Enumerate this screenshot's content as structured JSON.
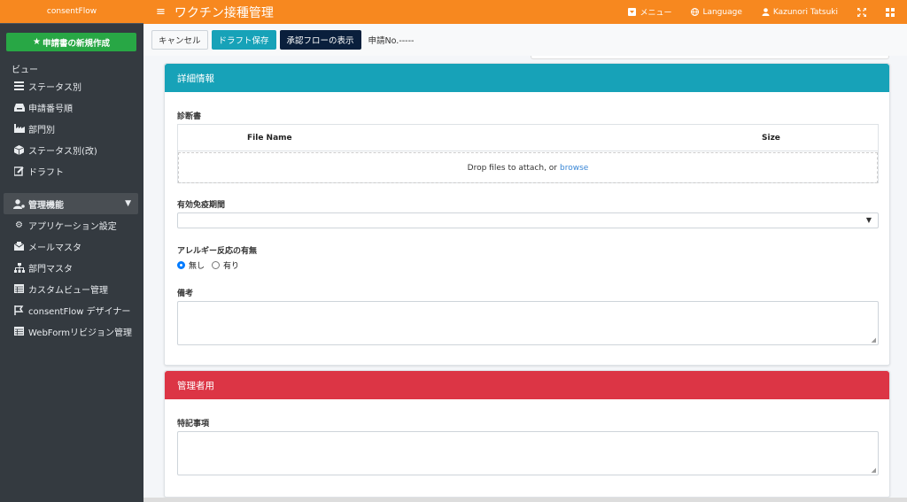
{
  "sidebar": {
    "brand": "consentFlow",
    "new_button": "申請書の新規作成",
    "view_label": "ビュー",
    "views": [
      {
        "icon": "list-icon",
        "label": "ステータス別"
      },
      {
        "icon": "inbox-icon",
        "label": "申請番号順"
      },
      {
        "icon": "industry-icon",
        "label": "部門別"
      },
      {
        "icon": "cube-icon",
        "label": "ステータス別(改)"
      },
      {
        "icon": "edit-icon",
        "label": "ドラフト"
      }
    ],
    "admin": {
      "icon": "user-cog-icon",
      "label": "管理機能"
    },
    "admin_items": [
      {
        "icon": "gear-icon",
        "label": "アプリケーション設定"
      },
      {
        "icon": "mail-icon",
        "label": "メールマスタ"
      },
      {
        "icon": "sitemap-icon",
        "label": "部門マスタ"
      },
      {
        "icon": "table-icon",
        "label": "カスタムビュー管理"
      },
      {
        "icon": "designer-icon",
        "label": "consentFlow デザイナー"
      },
      {
        "icon": "table-icon",
        "label": "WebFormリビジョン管理"
      }
    ]
  },
  "header": {
    "title": "ワクチン接種管理",
    "menu": "メニュー",
    "language": "Language",
    "user": "Kazunori Tatsuki"
  },
  "toolbar": {
    "cancel": "キャンセル",
    "draft": "ドラフト保存",
    "flow": "承認フローの表示",
    "app_no": "申請No.-----"
  },
  "card1": {
    "title": "詳細情報",
    "diagnosis_label": "診断書",
    "file_name_col": "File Name",
    "size_col": "Size",
    "drop_text": "Drop files to attach, or",
    "browse": "browse",
    "immunity_label": "有効免疫期間",
    "immunity_value": "",
    "allergy_label": "アレルギー反応の有無",
    "allergy_options": [
      "無し",
      "有り"
    ],
    "allergy_selected": "無し",
    "remarks_label": "備考",
    "remarks_value": ""
  },
  "card2": {
    "title": "管理者用",
    "notes_label": "特記事項",
    "notes_value": ""
  }
}
